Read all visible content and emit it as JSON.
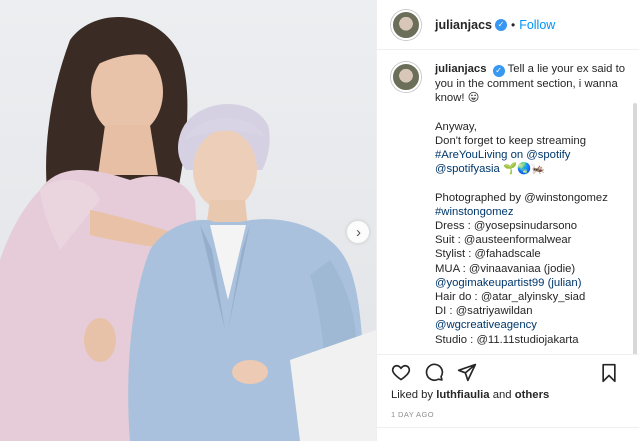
{
  "post": {
    "username": "julianjacs",
    "follow_label": "Follow",
    "separator": "•",
    "verified_glyph": "✓",
    "next_glyph": "›",
    "caption_lines": [
      "Tell a lie your ex said to you in the comment section, i wanna know! 😛",
      "",
      "Anyway,",
      "Don't forget to keep streaming",
      "#AreYouLiving on @spotify",
      "@spotifyasia 🌱🌏🦗",
      "",
      "Photographed by @winstongomez",
      "#winstongomez",
      "Dress : @yosepsinudarsono",
      "Suit : @austeenformalwear",
      "Stylist : @fahadscale",
      "MUA : @vinaavaniaa (jodie)",
      "@yogimakeupartist99 (julian)",
      "Hair do : @atar_alyinsky_siad",
      "DI : @satriyawildan",
      "@wgcreativeagency",
      "Studio : @11.11studiojakarta"
    ],
    "likes_prefix": "Liked by",
    "liked_by_user": "luthfiaulia",
    "likes_suffix": "and",
    "likes_others": "others",
    "timestamp": "1 DAY AGO"
  },
  "icons": {
    "like": "heart-icon",
    "comment": "comment-icon",
    "share": "share-icon",
    "save": "bookmark-icon",
    "verified": "verified-badge-icon",
    "next": "chevron-right-icon"
  },
  "colors": {
    "accent": "#0095f6",
    "verified": "#3897f0",
    "link": "#00376b",
    "muted": "#8e8e8e",
    "suit": "#a9c1dc",
    "dress": "#e6c9d8"
  }
}
